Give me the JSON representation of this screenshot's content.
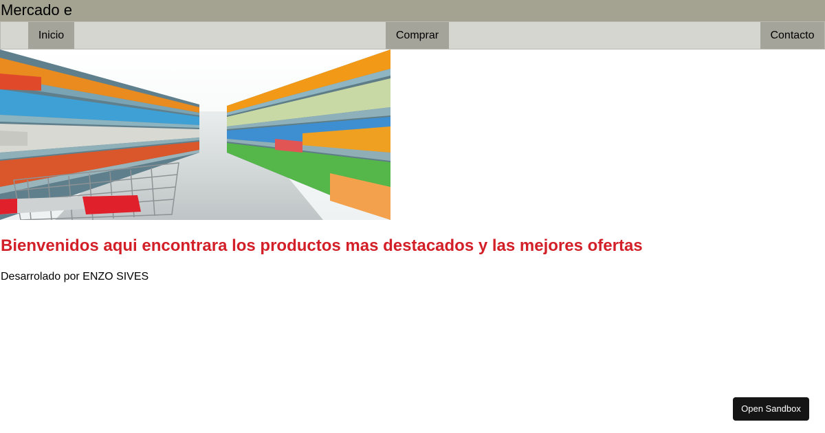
{
  "header": {
    "title": "Mercado e"
  },
  "nav": {
    "items": [
      {
        "label": "Inicio"
      },
      {
        "label": "Comprar"
      },
      {
        "label": "Contacto"
      }
    ]
  },
  "hero": {
    "image": "supermarket-aisle-with-shopping-cart"
  },
  "main": {
    "welcome_heading": "Bienvenidos aqui encontrara los productos mas destacados y las mejores ofertas",
    "credits": "Desarrolado por ENZO SIVES"
  },
  "sandbox": {
    "button_label": "Open Sandbox"
  },
  "colors": {
    "header_bg": "#a4a290",
    "nav_bg": "#d5d6d0",
    "nav_item_bg": "#a4a49b",
    "heading": "#d32028",
    "sandbox_bg": "#151515"
  }
}
